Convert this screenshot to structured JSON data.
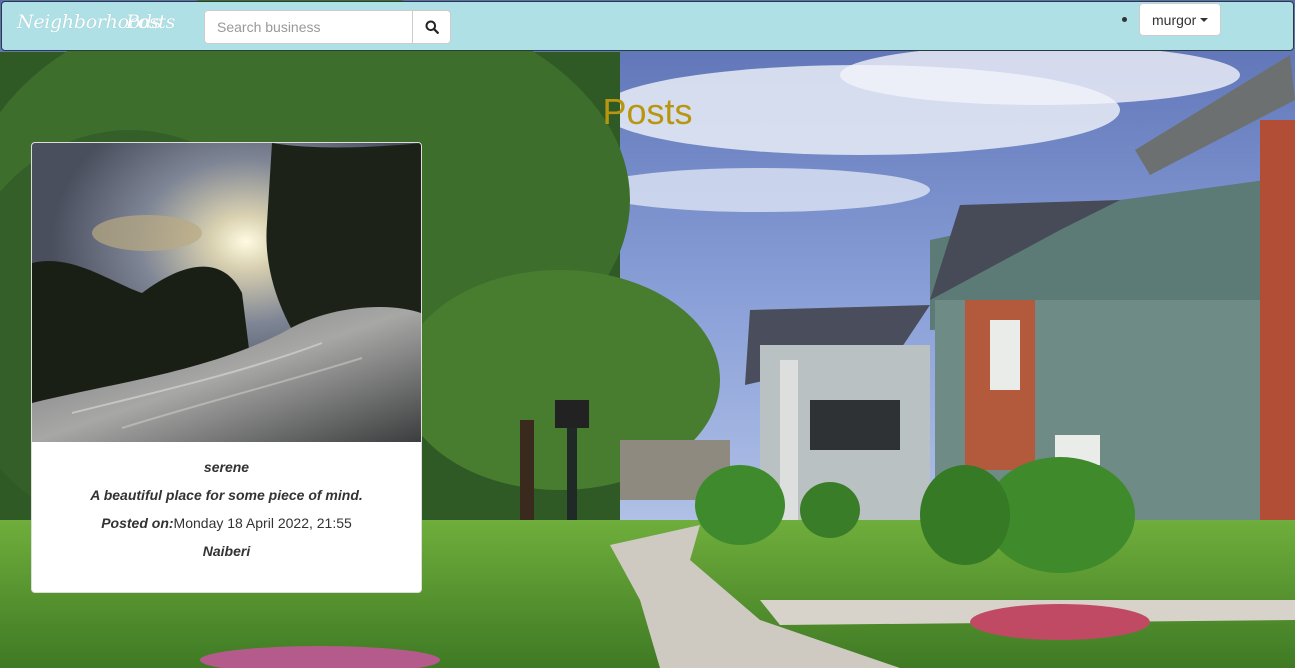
{
  "navbar": {
    "brand_home": "Neighborhoods",
    "brand_posts": "Posts",
    "search": {
      "placeholder": "Search business",
      "value": ""
    },
    "search_icon": "search-icon",
    "user": {
      "name": "murgor",
      "icon": "caret-down-icon"
    }
  },
  "page": {
    "heading": "Posts"
  },
  "posts": [
    {
      "title": "serene",
      "description": "A beautiful place for some piece of mind.",
      "posted_label": "Posted on:",
      "posted_date": "Monday 18 April 2022, 21:55",
      "neighborhood": "Naiberi"
    }
  ],
  "colors": {
    "navbar": "#aee0e6",
    "heading": "#b8960f",
    "card": "#ffffff"
  }
}
